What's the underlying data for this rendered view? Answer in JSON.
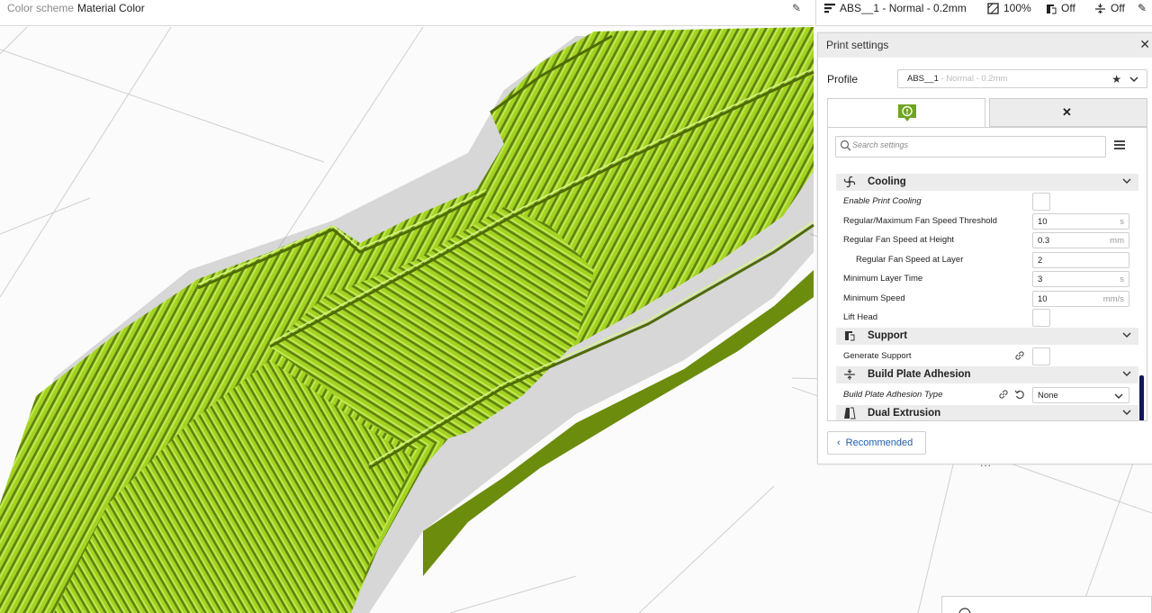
{
  "topbar": {
    "color_scheme_label": "Color scheme",
    "color_scheme_value": "Material Color",
    "edit_icon": "pencil-icon",
    "printer_icon": "printer-bars-icon",
    "profile_summary": "ABS__1 - Normal - 0.2mm",
    "infill_icon": "infill-icon",
    "infill_value": "100%",
    "support_icon": "support-icon",
    "support_value": "Off",
    "adhesion_icon": "adhesion-icon",
    "adhesion_value": "Off"
  },
  "panel": {
    "title": "Print settings",
    "profile_label": "Profile",
    "profile_name": "ABS__1",
    "profile_suffix": " - Normal - 0.2mm",
    "search_placeholder": "Search settings",
    "recommended_label": "Recommended",
    "handle": "..."
  },
  "sections": {
    "cooling": "Cooling",
    "support": "Support",
    "adhesion": "Build Plate Adhesion",
    "dual": "Dual Extrusion"
  },
  "cooling_settings": {
    "enable": "Enable Print Cooling",
    "threshold_label": "Regular/Maximum Fan Speed Threshold",
    "threshold_value": "10",
    "threshold_unit": "s",
    "height_label": "Regular Fan Speed at Height",
    "height_value": "0.3",
    "height_unit": "mm",
    "layer_label": "Regular Fan Speed at Layer",
    "layer_value": "2",
    "min_layer_time_label": "Minimum Layer Time",
    "min_layer_time_value": "3",
    "min_layer_time_unit": "s",
    "min_speed_label": "Minimum Speed",
    "min_speed_value": "10",
    "min_speed_unit": "mm/s",
    "lift_head_label": "Lift Head"
  },
  "support_settings": {
    "generate_label": "Generate Support"
  },
  "adhesion_settings": {
    "type_label": "Build Plate Adhesion Type",
    "type_value": "None"
  },
  "colors": {
    "filament": "#a3d321",
    "filament_dark": "#5d7d0a",
    "accent": "#14165c",
    "badge": "#6fa51f"
  }
}
